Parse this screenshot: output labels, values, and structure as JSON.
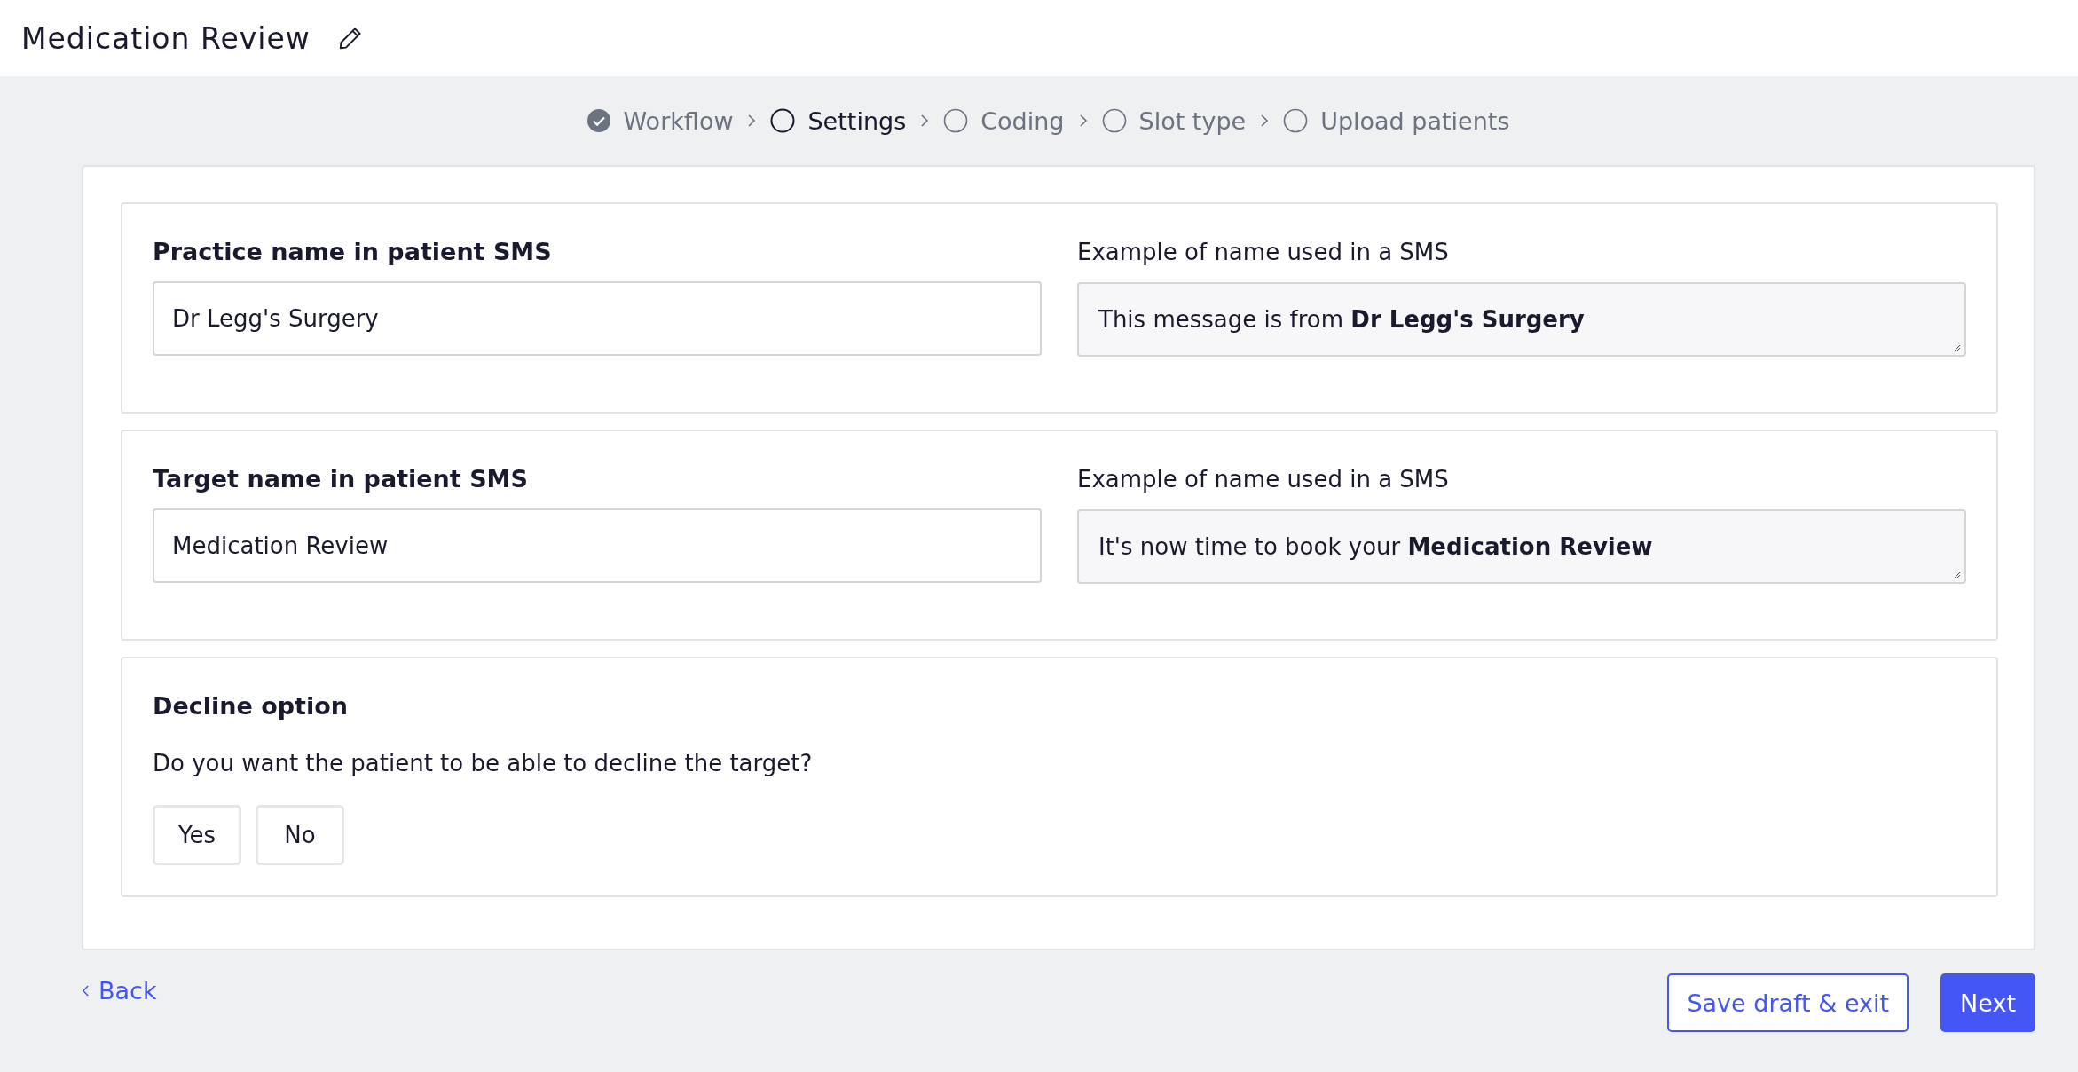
{
  "header": {
    "title": "Medication Review"
  },
  "steps": [
    {
      "label": "Workflow",
      "completed": true,
      "selected": false
    },
    {
      "label": "Settings",
      "completed": false,
      "selected": true
    },
    {
      "label": "Coding",
      "completed": false,
      "selected": false
    },
    {
      "label": "Slot type",
      "completed": false,
      "selected": false
    },
    {
      "label": "Upload patients",
      "completed": false,
      "selected": false
    }
  ],
  "sections": [
    {
      "kind": "name",
      "title": "Practice name in patient SMS",
      "value": "Dr Legg's Surgery",
      "preview_label": "Example of name used in a SMS",
      "preview": "This message is from **Dr Legg's Surgery**"
    },
    {
      "kind": "name",
      "title": "Target name in patient SMS",
      "value": "Medication Review",
      "preview_label": "Example of name used in a SMS",
      "preview": "It's now time to book your **Medication Review**"
    },
    {
      "kind": "choice",
      "title": "Decline option",
      "question": "Do you want the patient to be able to decline the target?",
      "options": [
        {
          "label": "Yes",
          "selected": false
        },
        {
          "label": "No",
          "selected": false
        }
      ]
    }
  ],
  "footer": {
    "back": "Back",
    "secondary": "Save draft & exit",
    "primary": "Next"
  }
}
